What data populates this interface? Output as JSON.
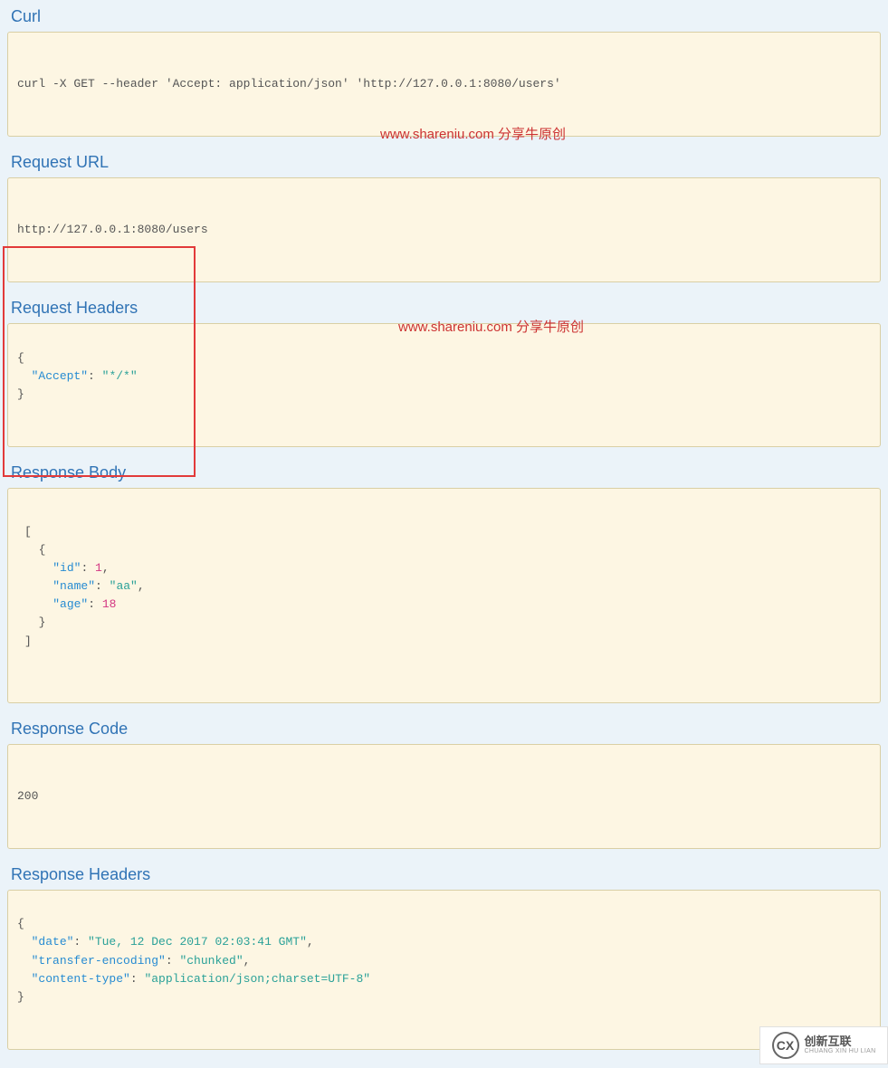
{
  "sections": {
    "curl": {
      "heading": "Curl",
      "content": "curl -X GET --header 'Accept: application/json' 'http://127.0.0.1:8080/users'"
    },
    "request_url": {
      "heading": "Request URL",
      "content": "http://127.0.0.1:8080/users"
    },
    "request_headers": {
      "heading": "Request Headers",
      "lines": {
        "l1": "{",
        "l2_key": "\"Accept\"",
        "l2_val": "\"*/*\"",
        "l3": "}"
      }
    },
    "response_body": {
      "heading": "Response Body",
      "json": {
        "l1": "[",
        "l2": "  {",
        "l3_key": "\"id\"",
        "l3_val": "1",
        "l4_key": "\"name\"",
        "l4_val": "\"aa\"",
        "l5_key": "\"age\"",
        "l5_val": "18",
        "l6": "  }",
        "l7": "]"
      }
    },
    "response_code": {
      "heading": "Response Code",
      "content": "200"
    },
    "response_headers": {
      "heading": "Response Headers",
      "lines": {
        "l1": "{",
        "l2_key": "\"date\"",
        "l2_val": "\"Tue, 12 Dec 2017 02:03:41 GMT\"",
        "l3_key": "\"transfer-encoding\"",
        "l3_val": "\"chunked\"",
        "l4_key": "\"content-type\"",
        "l4_val": "\"application/json;charset=UTF-8\"",
        "l5": "}"
      }
    }
  },
  "watermark": "www.shareniu.com 分享牛原创",
  "logo": {
    "cn": "创新互联",
    "en": "CHUANG XIN HU LIAN"
  }
}
